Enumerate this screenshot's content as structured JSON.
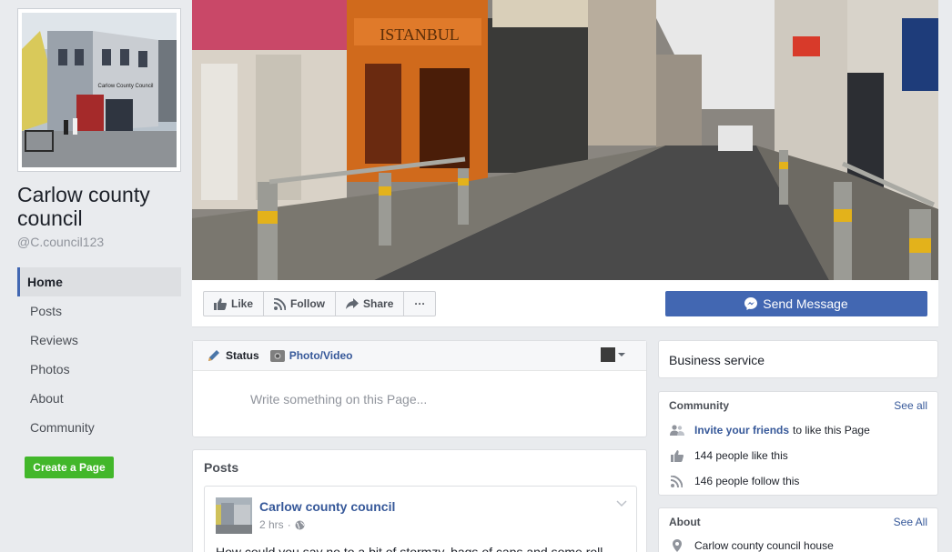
{
  "page": {
    "name": "Carlow county council",
    "handle": "@C.council123",
    "profile_image_sign": "Carlow County Council"
  },
  "nav": {
    "items": [
      {
        "label": "Home",
        "active": true
      },
      {
        "label": "Posts"
      },
      {
        "label": "Reviews"
      },
      {
        "label": "Photos"
      },
      {
        "label": "About"
      },
      {
        "label": "Community"
      }
    ],
    "create_page": "Create a Page"
  },
  "cover": {
    "shop_sign": "ISTANBUL"
  },
  "actions": {
    "like": "Like",
    "follow": "Follow",
    "share": "Share",
    "more": "···",
    "send_message": "Send Message"
  },
  "composer": {
    "tab_status": "Status",
    "tab_photo": "Photo/Video",
    "placeholder": "Write something on this Page..."
  },
  "posts": {
    "title": "Posts",
    "items": [
      {
        "author": "Carlow county council",
        "time": "2 hrs",
        "text": "How could you say no to a bit of stormzy, bags of caps and some roll"
      }
    ]
  },
  "sidebar": {
    "category": "Business service",
    "community": {
      "title": "Community",
      "see_all": "See all",
      "invite_link": "Invite your friends",
      "invite_rest": "to like this Page",
      "likes": "144 people like this",
      "follows": "146 people follow this"
    },
    "about": {
      "title": "About",
      "see_all": "See All",
      "address": "Carlow county council house"
    }
  },
  "colors": {
    "brand_blue": "#4267b2",
    "link_blue": "#365899",
    "green": "#42b72a",
    "background": "#e9ebee"
  }
}
